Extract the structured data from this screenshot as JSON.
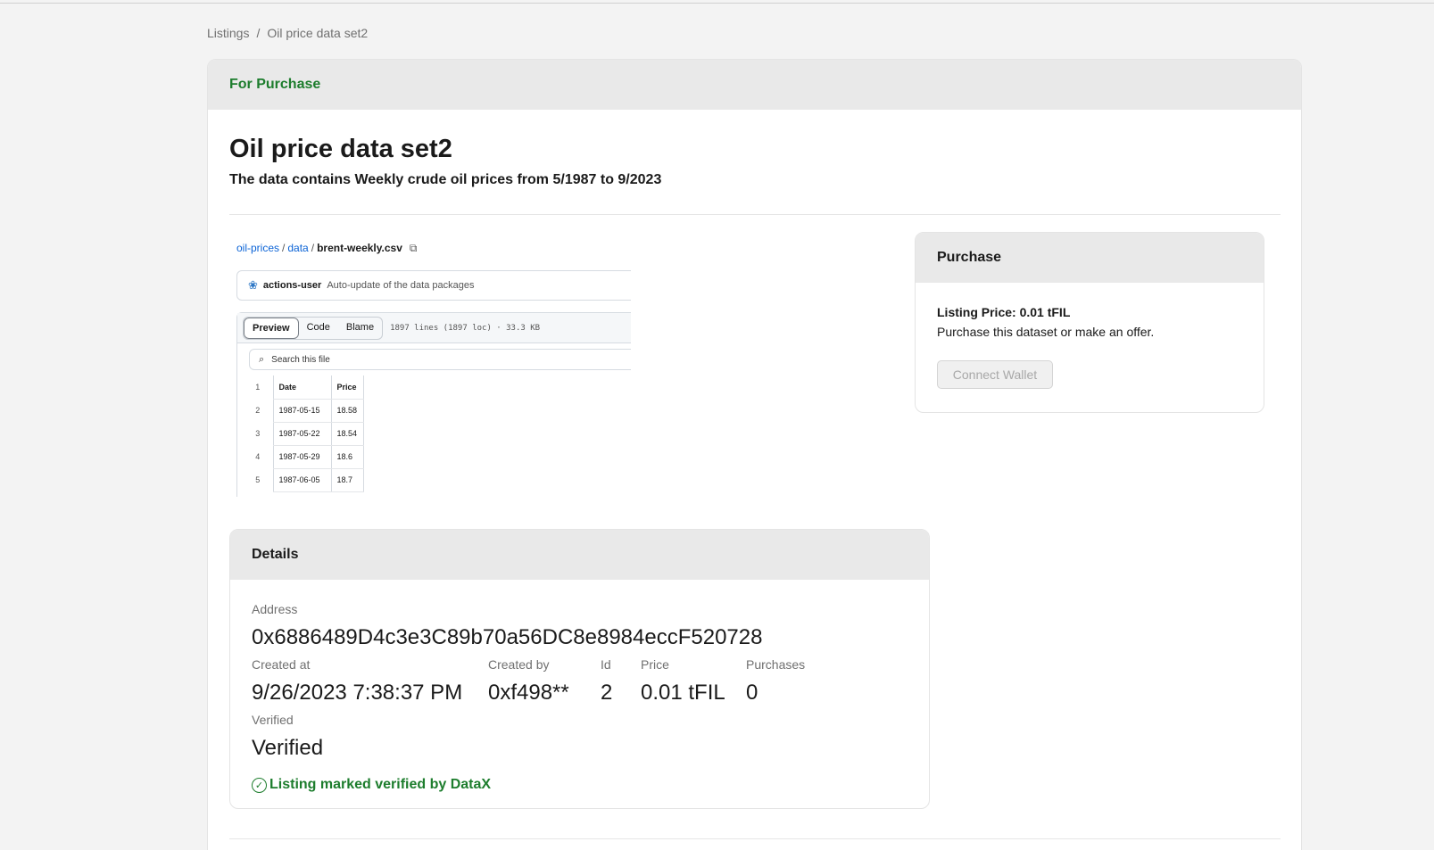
{
  "breadcrumb": {
    "root": "Listings",
    "separator": "/",
    "current": "Oil price data set2"
  },
  "status": {
    "label": "For Purchase",
    "color": "#1d7d2d"
  },
  "listing": {
    "title": "Oil price data set2",
    "description": "The data contains Weekly crude oil prices from 5/1987 to 9/2023"
  },
  "preview": {
    "path": {
      "repo": "oil-prices",
      "folder": "data",
      "file": "brent-weekly.csv",
      "sep": "/"
    },
    "copy_icon": "⧉",
    "commit": {
      "user": "actions-user",
      "message": "Auto-update of the data packages"
    },
    "tabs": [
      "Preview",
      "Code",
      "Blame"
    ],
    "file_meta": "1897 lines (1897 loc) · 33.3 KB",
    "search_placeholder": "Search this file",
    "table": {
      "headers": [
        "Date",
        "Price"
      ],
      "rows": [
        {
          "ln": "1",
          "date": "Date",
          "price": "Price"
        },
        {
          "ln": "2",
          "date": "1987-05-15",
          "price": "18.58"
        },
        {
          "ln": "3",
          "date": "1987-05-22",
          "price": "18.54"
        },
        {
          "ln": "4",
          "date": "1987-05-29",
          "price": "18.6"
        },
        {
          "ln": "5",
          "date": "1987-06-05",
          "price": "18.7"
        }
      ]
    }
  },
  "purchase": {
    "header": "Purchase",
    "listing_price": "Listing Price: 0.01 tFIL",
    "description": "Purchase this dataset or make an offer.",
    "button": "Connect Wallet"
  },
  "details": {
    "header": "Details",
    "address_label": "Address",
    "address": "0x6886489D4c3e3C89b70a56DC8e8984eccF520728",
    "created_at_label": "Created at",
    "created_at": "9/26/2023 7:38:37 PM",
    "created_by_label": "Created by",
    "created_by": "0xf498**",
    "id_label": "Id",
    "id": "2",
    "price_label": "Price",
    "price": "0.01 tFIL",
    "purchases_label": "Purchases",
    "purchases": "0",
    "verified_label": "Verified",
    "verified": "Verified",
    "verified_note": "Listing marked verified by DataX",
    "check_icon": "✓"
  }
}
